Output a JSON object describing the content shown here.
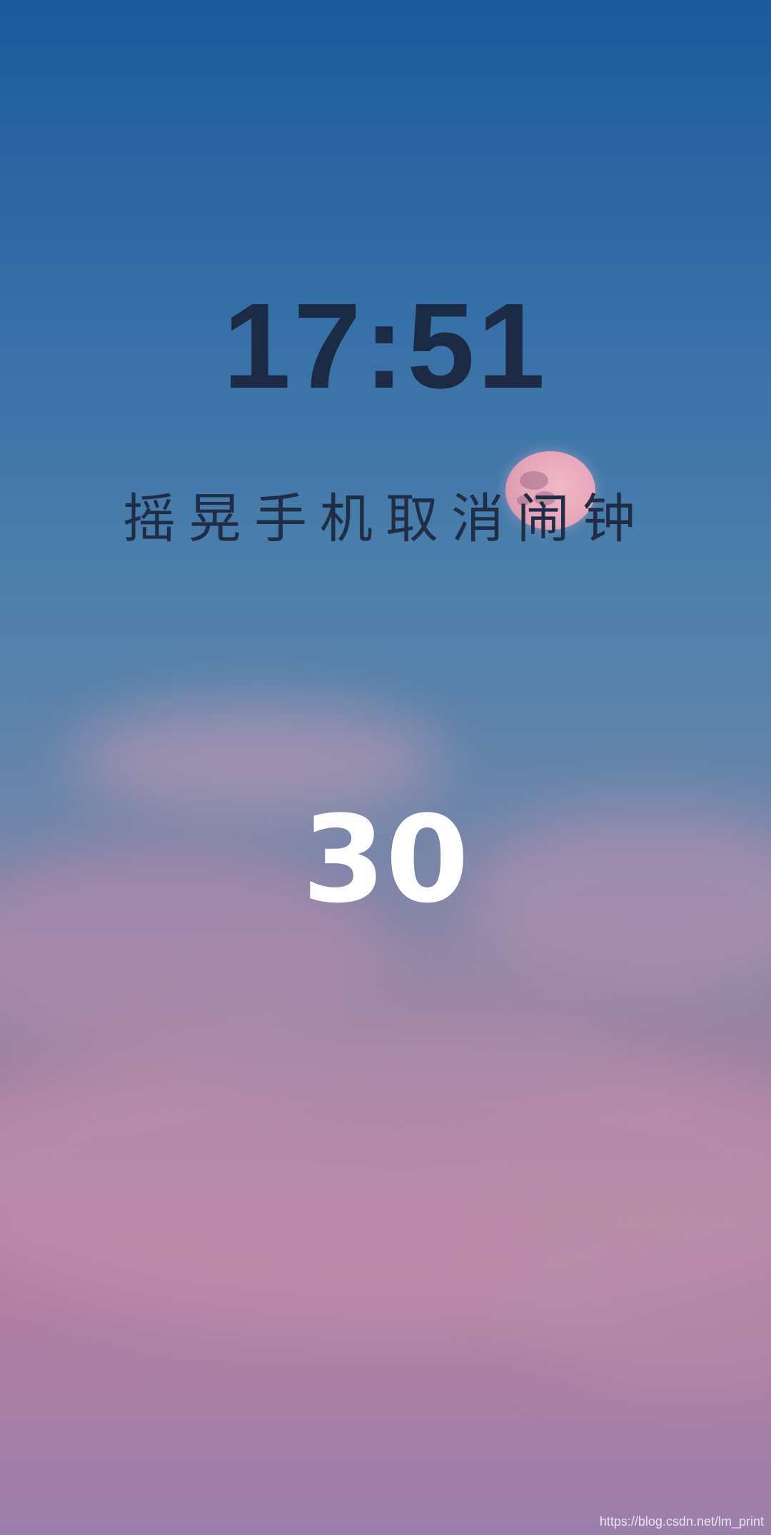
{
  "clock": {
    "time": "17:51"
  },
  "alarm": {
    "message": "摇晃手机取消闹钟",
    "countdown": "30"
  },
  "watermark": "https://blog.csdn.net/lm_print",
  "colors": {
    "sky_top": "#1d5a9c",
    "sky_bottom": "#9a7fab",
    "clock_text": "#1b2a45",
    "countdown_text": "#ffffff",
    "moon": "#e6a6ba"
  },
  "background": {
    "scene": "evening-sky-with-moon-and-clouds"
  }
}
